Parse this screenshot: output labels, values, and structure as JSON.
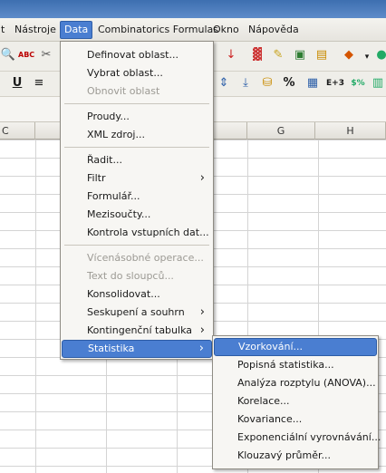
{
  "menubar": {
    "items": [
      "t",
      "Nástroje",
      "Data",
      "Combinatorics Formulas",
      "Okno",
      "Nápověda"
    ]
  },
  "toolbar": {
    "spell_label": "ABC",
    "underline_label": "U",
    "number_format_label": "E+3",
    "currency_label": "$%",
    "percent_label": "%"
  },
  "columns": [
    "C",
    "G",
    "H"
  ],
  "data_menu": {
    "items": [
      "Definovat oblast...",
      "Vybrat oblast...",
      "Obnovit oblast",
      "Proudy...",
      "XML zdroj...",
      "Řadit...",
      "Filtr",
      "Formulář...",
      "Mezisoučty...",
      "Kontrola vstupních dat...",
      "Vícenásobné operace...",
      "Text do sloupců...",
      "Konsolidovat...",
      "Seskupení a souhrn",
      "Kontingenční tabulka",
      "Statistika"
    ]
  },
  "statistics_submenu": {
    "items": [
      "Vzorkování...",
      "Popisná statistika...",
      "Analýza rozptylu (ANOVA)...",
      "Korelace...",
      "Kovariance...",
      "Exponenciální vyrovnávání...",
      "Klouzavý průměr..."
    ]
  },
  "colors": {
    "highlight": "#4a7ed1",
    "disabled_text": "#9c9a94"
  }
}
